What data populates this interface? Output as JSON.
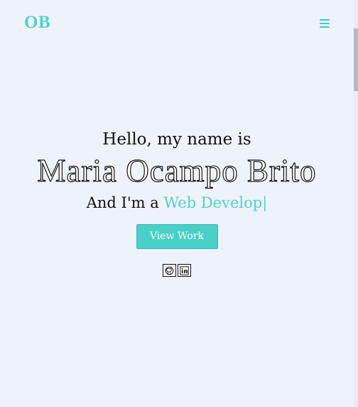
{
  "header": {
    "logo": "OB",
    "menu_icon": "hamburger-menu-icon",
    "accent_color": "#4fd1c9"
  },
  "hero": {
    "greeting": "Hello, my name is",
    "name": "Maria Ocampo Brito",
    "role_prefix": "And I'm a ",
    "role_typed": "Web Develop",
    "cursor": "|",
    "cta_label": "View Work"
  },
  "socials": [
    {
      "icon": "github-icon"
    },
    {
      "icon": "linkedin-icon"
    }
  ]
}
